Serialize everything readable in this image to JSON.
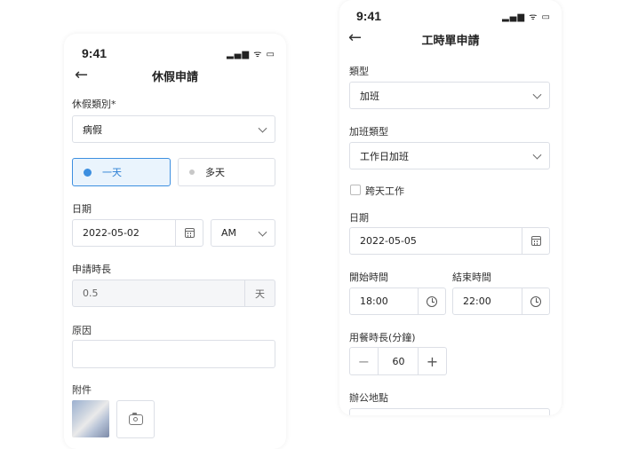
{
  "status": {
    "time": "9:41",
    "icons": "signal-wifi-battery"
  },
  "leave": {
    "title": "休假申請",
    "type_label": "休假類別*",
    "type_value": "病假",
    "option_one_day": "一天",
    "option_multi_day": "多天",
    "date_label": "日期",
    "date_value": "2022-05-02",
    "period_value": "AM",
    "duration_label": "申請時長",
    "duration_value": "0.5",
    "duration_unit": "天",
    "reason_label": "原因",
    "reason_value": "",
    "attachment_label": "附件"
  },
  "timesheet": {
    "title": "工時單申請",
    "type_label": "類型",
    "type_value": "加班",
    "ot_type_label": "加班類型",
    "ot_type_value": "工作日加班",
    "cross_day_label": "跨天工作",
    "date_label": "日期",
    "date_value": "2022-05-05",
    "start_label": "開始時間",
    "start_value": "18:00",
    "end_label": "結束時間",
    "end_value": "22:00",
    "meal_label": "用餐時長(分鐘)",
    "meal_value": "60",
    "minus": "−",
    "plus": "+",
    "office_label": "辦公地點"
  },
  "colors": {
    "accent": "#3d8fe0",
    "border": "#dcdfe6"
  }
}
